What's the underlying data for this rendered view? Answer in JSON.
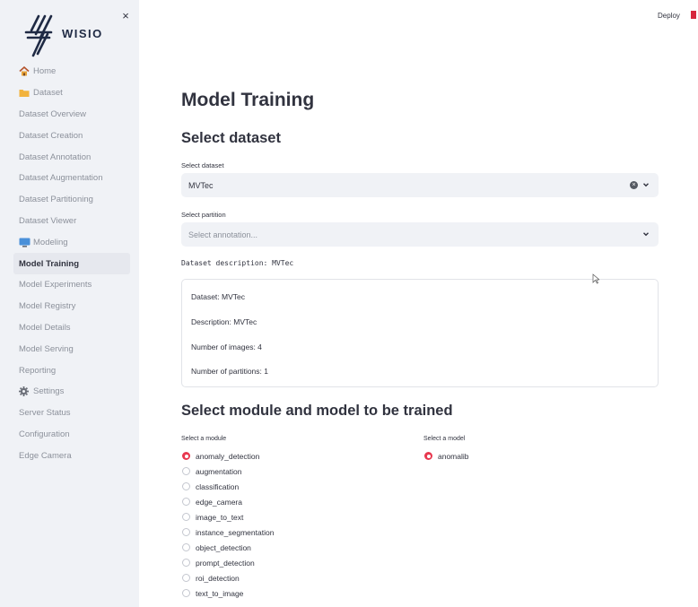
{
  "sidebar": {
    "brand": "WISIO",
    "close_label": "×",
    "items": [
      {
        "label": "Home",
        "icon": "home-icon"
      },
      {
        "label": "Dataset",
        "icon": "folder-icon"
      },
      {
        "label": "Dataset Overview"
      },
      {
        "label": "Dataset Creation"
      },
      {
        "label": "Dataset Annotation"
      },
      {
        "label": "Dataset Augmentation"
      },
      {
        "label": "Dataset Partitioning"
      },
      {
        "label": "Dataset Viewer"
      },
      {
        "label": "Modeling",
        "icon": "monitor-icon"
      },
      {
        "label": "Model Training",
        "active": true
      },
      {
        "label": "Model Experiments"
      },
      {
        "label": "Model Registry"
      },
      {
        "label": "Model Details"
      },
      {
        "label": "Model Serving"
      },
      {
        "label": "Reporting"
      },
      {
        "label": "Settings",
        "icon": "gear-icon"
      },
      {
        "label": "Server Status"
      },
      {
        "label": "Configuration"
      },
      {
        "label": "Edge Camera"
      }
    ]
  },
  "header": {
    "deploy_label": "Deploy"
  },
  "main": {
    "title": "Model Training",
    "dataset_section": {
      "title": "Select dataset",
      "dataset_label": "Select dataset",
      "dataset_value": "MVTec",
      "partition_label": "Select partition",
      "partition_placeholder": "Select annotation...",
      "description_line": "Dataset description: MVTec"
    },
    "info": {
      "dataset": "Dataset: MVTec",
      "description": "Description: MVTec",
      "images": "Number of images: 4",
      "partitions": "Number of partitions: 1"
    },
    "module_section": {
      "title": "Select module and model to be trained",
      "module_label": "Select a module",
      "model_label": "Select a model",
      "modules": [
        {
          "label": "anomaly_detection",
          "selected": true
        },
        {
          "label": "augmentation",
          "selected": false
        },
        {
          "label": "classification",
          "selected": false
        },
        {
          "label": "edge_camera",
          "selected": false
        },
        {
          "label": "image_to_text",
          "selected": false
        },
        {
          "label": "instance_segmentation",
          "selected": false
        },
        {
          "label": "object_detection",
          "selected": false
        },
        {
          "label": "prompt_detection",
          "selected": false
        },
        {
          "label": "roi_detection",
          "selected": false
        },
        {
          "label": "text_to_image",
          "selected": false
        }
      ],
      "models": [
        {
          "label": "anomalib",
          "selected": true
        }
      ]
    }
  },
  "colors": {
    "accent": "#e8384f",
    "sidebar_bg": "#f0f2f6",
    "text": "#31333f",
    "muted": "#8c919b"
  }
}
